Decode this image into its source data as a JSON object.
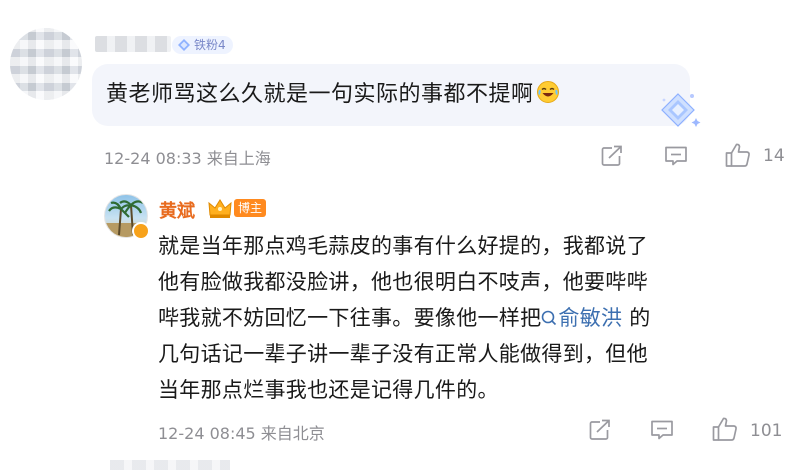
{
  "comment": {
    "fan_badge": "铁粉4",
    "text": "黄老师骂这么久就是一句实际的事都不提啊",
    "emoji": "laughing-crying-emoji",
    "timestamp": "12-24 08:33",
    "location": "来自上海",
    "like_count": "14"
  },
  "reply": {
    "author": "黄斌",
    "author_color": "#e86b1f",
    "badge": "博主",
    "badge_color": "#ff8a1f",
    "lines": [
      "就是当年那点鸡毛蒜皮的事有什么好提的，我都说了",
      "他有脸做我都没脸讲，他也很明白不吱声，他要哔哔",
      "哔我就不妨回忆一下往事。要像他一样把",
      "几句话记一辈子讲一辈子没有正常人能做得到，但他",
      "当年那点烂事我也还是记得几件的。"
    ],
    "mention": "俞敏洪",
    "mention_suffix": " 的",
    "mention_color": "#3c6fb0",
    "timestamp": "12-24 08:45",
    "location": "来自北京",
    "like_count": "101"
  },
  "icons": [
    "share-icon",
    "comment-icon",
    "thumbs-up-icon",
    "search-mention-icon",
    "crown-icon",
    "diamond-gem-icon"
  ]
}
